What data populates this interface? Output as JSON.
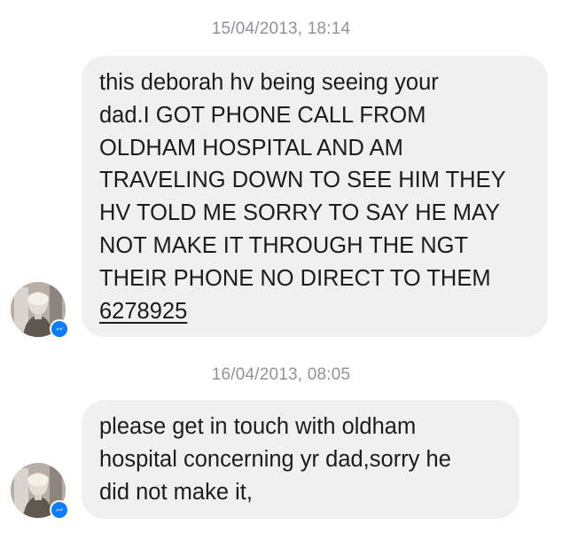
{
  "conversation": {
    "messages": [
      {
        "timestamp": "15/04/2013, 18:14",
        "lines": [
          "this deborah hv being seeing your",
          "dad.I GOT PHONE CALL FROM",
          "OLDHAM HOSPITAL AND AM",
          "TRAVELING DOWN TO SEE HIM THEY",
          "HV TOLD ME SORRY TO SAY HE MAY",
          "NOT MAKE IT THROUGH THE NGT",
          "THEIR PHONE NO DIRECT TO THEM"
        ],
        "phone_link": "6278925",
        "avatar": {
          "badge_icon": "messenger-icon"
        }
      },
      {
        "timestamp": "16/04/2013, 08:05",
        "lines": [
          "please get in touch with oldham",
          "hospital concerning yr dad,sorry he",
          "did not make it,"
        ],
        "avatar": {
          "badge_icon": "messenger-icon"
        }
      }
    ]
  },
  "colors": {
    "bubble_background": "#f1f0f0",
    "timestamp_text": "#8f9399",
    "message_text": "#1b1c1e",
    "messenger_badge": "#0a7cff"
  }
}
